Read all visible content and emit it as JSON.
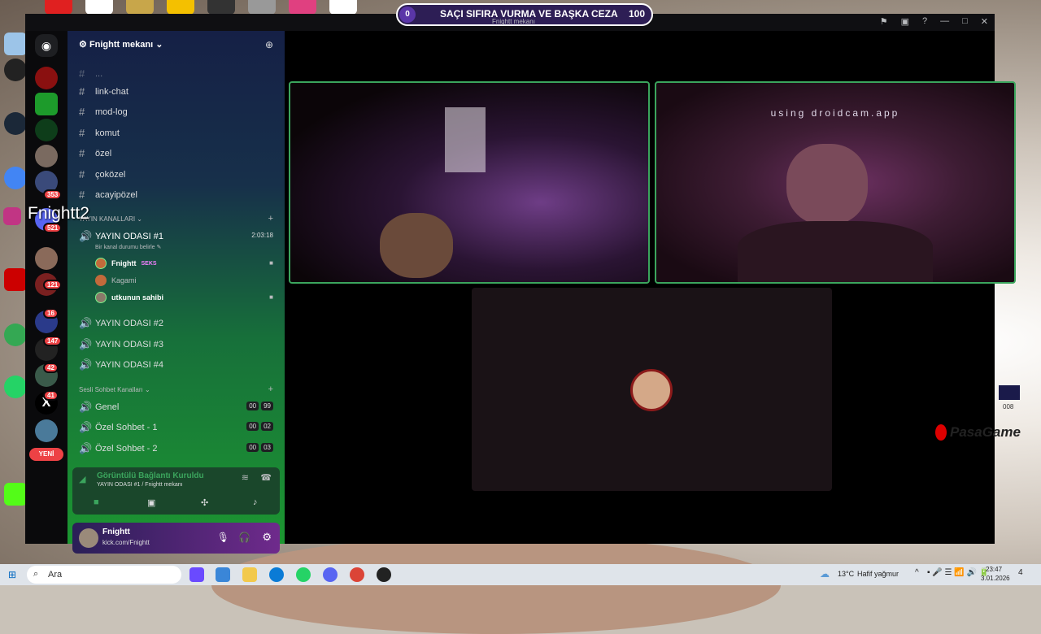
{
  "overlay": {
    "left_score": "0",
    "title": "SAÇI SIFIRA VURMA VE BAŞKA CEZA",
    "right_score": "100",
    "subtitle": "Fnightt mekanı",
    "streamer_tag": "Fnightt2",
    "brand": "PasaGame",
    "badge_text": "008"
  },
  "window": {
    "icons": [
      "flag-icon",
      "screen-icon",
      "help-icon",
      "minimize-icon",
      "maximize-icon",
      "close-icon"
    ]
  },
  "rail": {
    "badges": [
      "353",
      "521",
      "121",
      "16",
      "147",
      "42",
      "41"
    ],
    "new_label": "YENİ"
  },
  "server": {
    "name": "Fnightt mekanı",
    "partial_channel": "...",
    "text_channels": [
      "link-chat",
      "mod-log",
      "komut",
      "özel",
      "çoközel",
      "acayipözel"
    ],
    "stream_category": "YAYIN KANALLARI",
    "active_channel": "YAYIN ODASI #1",
    "active_time": "2:03:18",
    "status_hint": "Bir kanal durumu belirle",
    "users": [
      {
        "name": "Fnightt",
        "tag": "SEKS",
        "camera": true
      },
      {
        "name": "Kagami",
        "tag": "",
        "camera": false
      },
      {
        "name": "utkunun sahibi",
        "tag": "",
        "camera": true
      }
    ],
    "other_stream_channels": [
      "YAYIN ODASI #2",
      "YAYIN ODASI #3",
      "YAYIN ODASI #4"
    ],
    "voice_category": "Sesli Sohbet Kanalları",
    "voice_channels": [
      {
        "name": "Genel",
        "a": "00",
        "b": "99"
      },
      {
        "name": "Özel Sohbet - 1",
        "a": "00",
        "b": "02"
      },
      {
        "name": "Özel Sohbet - 2",
        "a": "00",
        "b": "03"
      }
    ]
  },
  "voice_status": {
    "title": "Görüntülü Bağlantı Kuruldu",
    "detail": "YAYIN ODASI #1 / Fnightt mekanı"
  },
  "user_panel": {
    "name": "Fnightt",
    "status": "kick.com/Fnightt"
  },
  "video": {
    "cam2_overlay": "using droidcam.app"
  },
  "taskbar": {
    "search_placeholder": "Ara",
    "weather_temp": "13°C",
    "weather_text": "Hafif yağmur",
    "time": "23:47",
    "date": "3.01.2026",
    "notifications": "4"
  },
  "colors": {
    "discord_green": "#3ba55d",
    "banner_purple": "#2d1e55",
    "badge_red": "#ed4245"
  }
}
